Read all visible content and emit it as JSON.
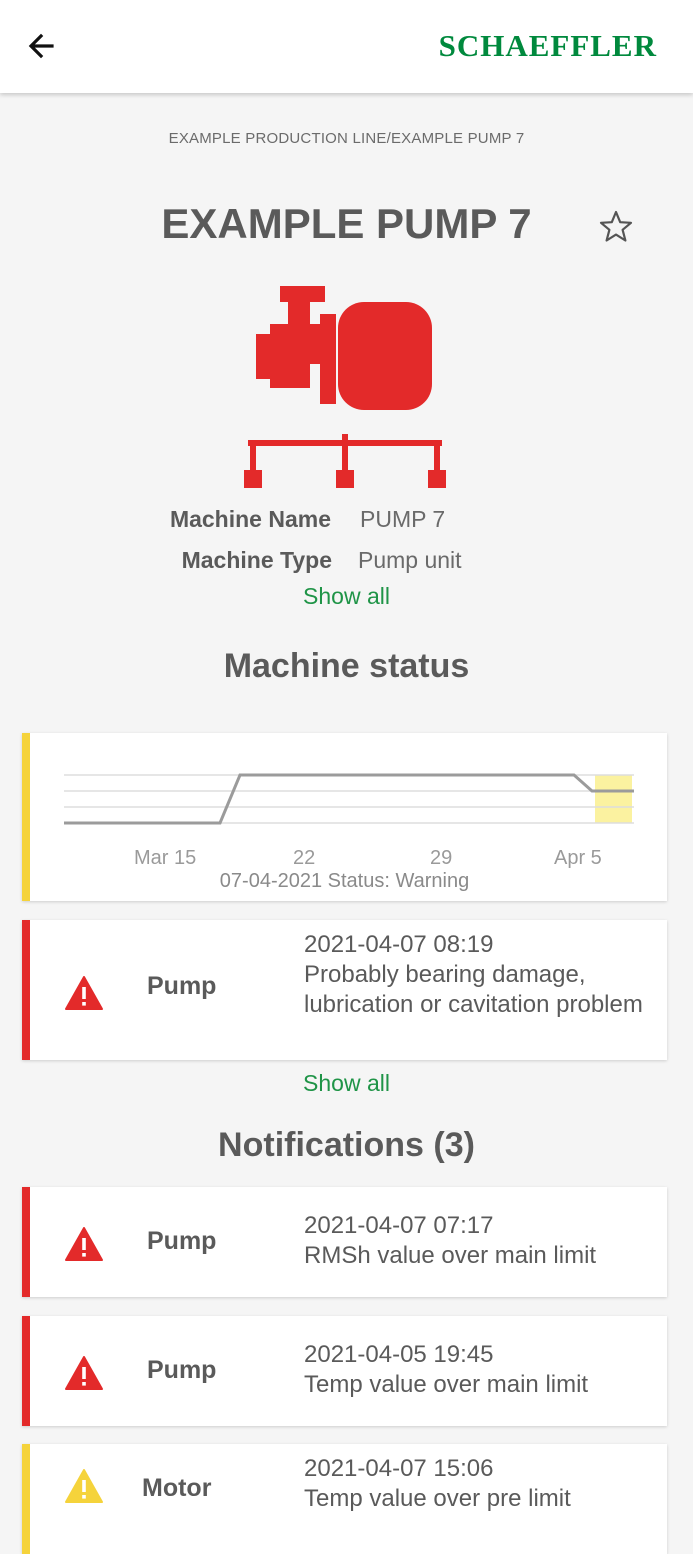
{
  "header": {
    "brand": "SCHAEFFLER",
    "back_icon": "arrow-left-icon"
  },
  "breadcrumb": "EXAMPLE PRODUCTION LINE/EXAMPLE PUMP 7",
  "title": "EXAMPLE PUMP 7",
  "favorite_icon": "star-outline-icon",
  "machine_icon": "pump-unit-icon",
  "colors": {
    "brand": "#00893d",
    "link": "#1f9447",
    "alarm": "#e32a2a",
    "warning": "#f5d33b"
  },
  "properties": [
    {
      "label": "Machine Name",
      "value": "PUMP 7"
    },
    {
      "label": "Machine Type",
      "value": "Pump unit"
    }
  ],
  "show_all_properties": "Show all",
  "machine_status": {
    "title": "Machine status",
    "chart_data": {
      "type": "line",
      "x_tick_labels": [
        "Mar 15",
        "22",
        "29",
        "Apr 5"
      ],
      "status_levels": 4,
      "highlight_last_period": "warning",
      "caption": "07-04-2021 Status: Warning"
    },
    "latest_alert": {
      "severity": "alarm",
      "component": "Pump",
      "timestamp": "2021-04-07 08:19",
      "message": "Probably bearing damage, lubrication or cavitation problem"
    },
    "show_all": "Show all"
  },
  "notifications": {
    "title": "Notifications (3)",
    "items": [
      {
        "severity": "alarm",
        "component": "Pump",
        "timestamp": "2021-04-07 07:17",
        "message": "RMSh value over main limit"
      },
      {
        "severity": "alarm",
        "component": "Pump",
        "timestamp": "2021-04-05 19:45",
        "message": "Temp value over main limit"
      },
      {
        "severity": "warning",
        "component": "Motor",
        "timestamp": "2021-04-07 15:06",
        "message": "Temp value over pre limit"
      }
    ]
  }
}
